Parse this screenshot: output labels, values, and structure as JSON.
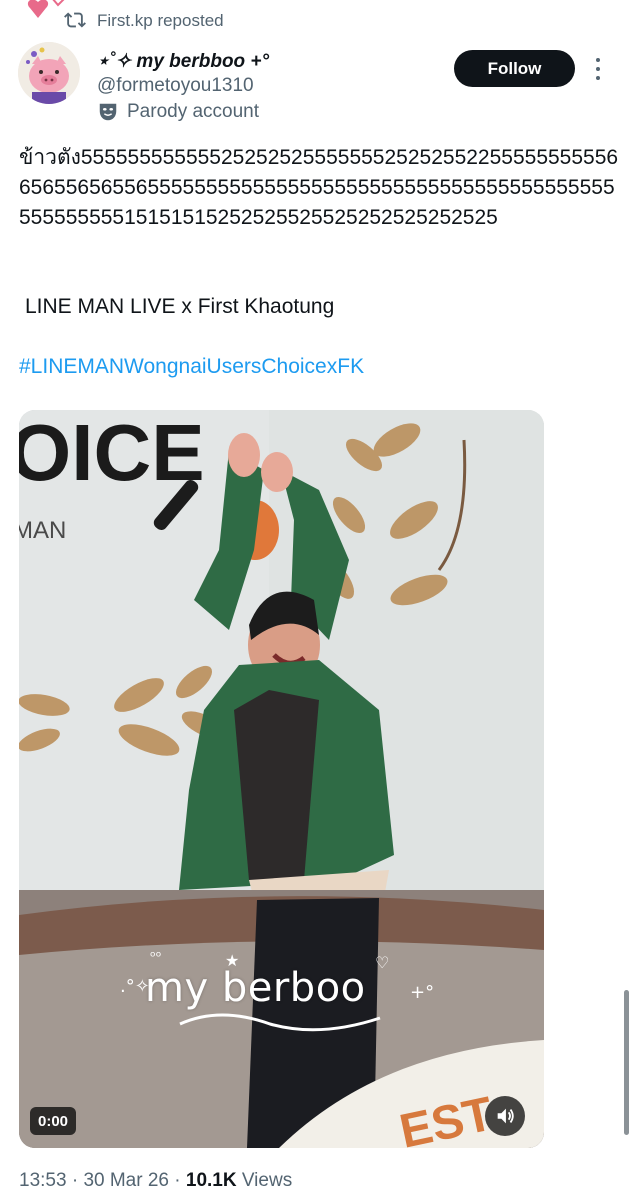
{
  "repost": {
    "text": "First.kp reposted"
  },
  "author": {
    "name": "⋆˚✧ my berbboo +°",
    "handle": "@formetoyou1310",
    "label": "Parody account"
  },
  "actions": {
    "follow_label": "Follow"
  },
  "tweet": {
    "text": "ข้าวตัง555555555555252525255555552525255225555555555665655656556555555555555555555555555555555555555555555555555515151515252525525525252525252525",
    "line2": "LINE MAN LIVE x First Khaotung",
    "hashtag": "#LINEMANWongnaiUsersChoicexFK"
  },
  "media": {
    "sign_text": "OICE",
    "sign_subtext": "MAN",
    "watermark": "my berboo",
    "duration": "0:00"
  },
  "meta": {
    "time": "13:53",
    "separator": " · ",
    "date": "30 Mar 26",
    "separator2": " · ",
    "views_count": "10.1K",
    "views_label": " Views"
  },
  "colors": {
    "accent": "#1d9bf0",
    "text": "#0f1419",
    "secondary": "#536471",
    "jacket": "#2f6b45"
  }
}
